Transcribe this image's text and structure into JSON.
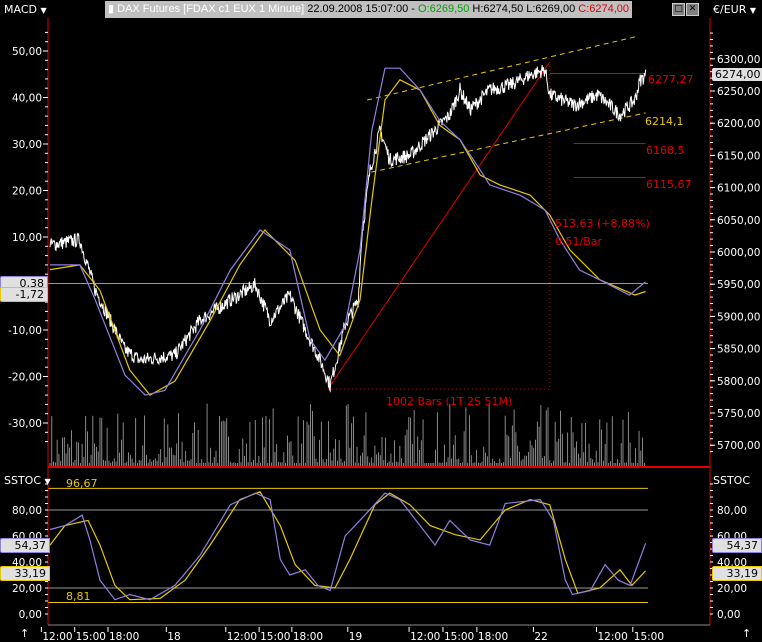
{
  "header": {
    "left_indicator": "MACD",
    "candle_icon": "candle-icon",
    "instrument": "DAX Futures [FDAX c1 EUX  1 Minute]",
    "datetime": "22.09.2008 15:07:00 -",
    "open": "O:6269,50",
    "high": "H:6274,50",
    "low": "L:6269,00",
    "close": "C:6274,00",
    "currency": "€/EUR",
    "maximize": "□",
    "close_btn": "✕"
  },
  "colors": {
    "up": "#00a000",
    "down": "#e00000",
    "macd": "#9080e0",
    "signal": "#e8c800",
    "price": "#ffffff",
    "annot": "#e00000",
    "trend": "#e8c800",
    "stoc_k": "#9080e0",
    "stoc_d": "#e8c800"
  },
  "main": {
    "price_axis": {
      "min": 5675,
      "max": 6350,
      "labels": [
        "6300,00",
        "6250,00",
        "6200,00",
        "6150,00",
        "6100,00",
        "6050,00",
        "6000,00",
        "5950,00",
        "5900,00",
        "5850,00",
        "5800,00",
        "5750,00",
        "5700,00"
      ],
      "values": [
        6300,
        6250,
        6200,
        6150,
        6100,
        6050,
        6000,
        5950,
        5900,
        5850,
        5800,
        5750,
        5700
      ]
    },
    "macd_axis": {
      "labels": [
        "50,00",
        "40,00",
        "30,00",
        "20,00",
        "10,00",
        "-10,00",
        "-20,00",
        "-30,00"
      ],
      "values": [
        50,
        40,
        30,
        20,
        10,
        -10,
        -20,
        -30
      ]
    },
    "last_price_label": "6274,00",
    "macd_label": "0,38",
    "signal_label": "-1,72",
    "annotations": {
      "level_1": "6277,27",
      "level_trend": "6214,1",
      "level_2": "6168,5",
      "level_3": "6115,67",
      "move": "513,63 (+8,88%)",
      "rate": "0,51/Bar",
      "bars": "1002 Bars (1T 2S 51M)"
    },
    "price_anchors": [
      [
        0,
        6011
      ],
      [
        50,
        6019
      ],
      [
        76,
        5941
      ],
      [
        126,
        5848
      ],
      [
        151,
        5832
      ],
      [
        210,
        5840
      ],
      [
        252,
        5894
      ],
      [
        303,
        5925
      ],
      [
        345,
        5949
      ],
      [
        370,
        5894
      ],
      [
        403,
        5933
      ],
      [
        429,
        5879
      ],
      [
        454,
        5832
      ],
      [
        471,
        5793
      ],
      [
        496,
        5887
      ],
      [
        518,
        5925
      ],
      [
        524,
        6026
      ],
      [
        538,
        6127
      ],
      [
        555,
        6189
      ],
      [
        571,
        6143
      ],
      [
        605,
        6150
      ],
      [
        647,
        6189
      ],
      [
        672,
        6213
      ],
      [
        689,
        6252
      ],
      [
        706,
        6221
      ],
      [
        739,
        6252
      ],
      [
        773,
        6259
      ],
      [
        807,
        6275
      ],
      [
        832,
        6283
      ],
      [
        840,
        6244
      ],
      [
        882,
        6228
      ],
      [
        921,
        6244
      ],
      [
        958,
        6213
      ],
      [
        983,
        6236
      ],
      [
        992,
        6267
      ],
      [
        1001,
        6274
      ]
    ],
    "macd": [
      [
        0,
        4
      ],
      [
        50,
        4
      ],
      [
        76,
        -3.5
      ],
      [
        126,
        -19.7
      ],
      [
        160,
        -24
      ],
      [
        193,
        -23
      ],
      [
        252,
        -10
      ],
      [
        303,
        2.9
      ],
      [
        353,
        11.5
      ],
      [
        403,
        7.2
      ],
      [
        437,
        -12
      ],
      [
        462,
        -16.5
      ],
      [
        496,
        -9
      ],
      [
        521,
        7.2
      ],
      [
        541,
        33
      ],
      [
        563,
        46.3
      ],
      [
        588,
        46.3
      ],
      [
        622,
        41.6
      ],
      [
        655,
        35
      ],
      [
        689,
        30.9
      ],
      [
        723,
        24.4
      ],
      [
        739,
        21.2
      ],
      [
        790,
        19
      ],
      [
        832,
        15.8
      ],
      [
        857,
        9.4
      ],
      [
        890,
        2.9
      ],
      [
        924,
        0.8
      ],
      [
        974,
        -2.5
      ],
      [
        1001,
        0.38
      ]
    ],
    "signal": [
      [
        0,
        3
      ],
      [
        50,
        4
      ],
      [
        84,
        -1.5
      ],
      [
        134,
        -18.6
      ],
      [
        168,
        -24
      ],
      [
        210,
        -21
      ],
      [
        269,
        -8
      ],
      [
        319,
        4
      ],
      [
        361,
        11.5
      ],
      [
        412,
        5
      ],
      [
        454,
        -10
      ],
      [
        487,
        -15.5
      ],
      [
        521,
        -3.5
      ],
      [
        541,
        18
      ],
      [
        563,
        39.5
      ],
      [
        588,
        43.8
      ],
      [
        622,
        41.6
      ],
      [
        655,
        34
      ],
      [
        689,
        30.9
      ],
      [
        723,
        23.3
      ],
      [
        756,
        21.2
      ],
      [
        807,
        19
      ],
      [
        840,
        14.7
      ],
      [
        874,
        7.2
      ],
      [
        924,
        0.8
      ],
      [
        983,
        -2.5
      ],
      [
        1001,
        -1.72
      ]
    ],
    "trend_upper": [
      [
        533,
        6236
      ],
      [
        983,
        6334
      ]
    ],
    "trend_lower": [
      [
        540,
        6124
      ],
      [
        1001,
        6216
      ]
    ],
    "measure": {
      "from": [
        467,
        5787
      ],
      "to": [
        840,
        6295
      ]
    }
  },
  "stoc": {
    "title": "SSTOC",
    "right_title": "SSTOC",
    "axis_labels": [
      "80,00",
      "60,00",
      "40,00",
      "20,00",
      "0,00"
    ],
    "axis_values": [
      80,
      60,
      40,
      20,
      0
    ],
    "upper_level": "96,67",
    "lower_level": "8,81",
    "k_label": "54,37",
    "d_label": "33,19",
    "k": [
      [
        0,
        65
      ],
      [
        25,
        68
      ],
      [
        54,
        76
      ],
      [
        67,
        57
      ],
      [
        84,
        26
      ],
      [
        109,
        11
      ],
      [
        134,
        15
      ],
      [
        168,
        11
      ],
      [
        210,
        22
      ],
      [
        252,
        45
      ],
      [
        303,
        84
      ],
      [
        345,
        93
      ],
      [
        370,
        88
      ],
      [
        387,
        42
      ],
      [
        403,
        30
      ],
      [
        429,
        34
      ],
      [
        450,
        22
      ],
      [
        471,
        18
      ],
      [
        496,
        60
      ],
      [
        529,
        76
      ],
      [
        563,
        93
      ],
      [
        588,
        88
      ],
      [
        622,
        68
      ],
      [
        647,
        53
      ],
      [
        672,
        72
      ],
      [
        706,
        57
      ],
      [
        739,
        53
      ],
      [
        765,
        85
      ],
      [
        824,
        88
      ],
      [
        846,
        72
      ],
      [
        866,
        26
      ],
      [
        878,
        15
      ],
      [
        908,
        18
      ],
      [
        933,
        38
      ],
      [
        955,
        26
      ],
      [
        975,
        22
      ],
      [
        1001,
        54.37
      ]
    ],
    "d": [
      [
        0,
        53
      ],
      [
        25,
        68
      ],
      [
        64,
        72
      ],
      [
        84,
        53
      ],
      [
        109,
        22
      ],
      [
        134,
        11
      ],
      [
        185,
        12
      ],
      [
        227,
        26
      ],
      [
        269,
        53
      ],
      [
        319,
        88
      ],
      [
        353,
        94
      ],
      [
        387,
        68
      ],
      [
        412,
        38
      ],
      [
        445,
        22
      ],
      [
        479,
        20
      ],
      [
        504,
        42
      ],
      [
        546,
        84
      ],
      [
        571,
        93
      ],
      [
        605,
        84
      ],
      [
        639,
        68
      ],
      [
        681,
        61
      ],
      [
        723,
        57
      ],
      [
        765,
        80
      ],
      [
        807,
        88
      ],
      [
        840,
        84
      ],
      [
        866,
        42
      ],
      [
        887,
        16
      ],
      [
        924,
        20
      ],
      [
        958,
        34
      ],
      [
        978,
        22
      ],
      [
        1001,
        33.19
      ]
    ]
  },
  "time_axis": {
    "labels": [
      "12:00",
      "15:00",
      "18:00",
      "18",
      "12:00",
      "15:00",
      "18:00",
      "19",
      "12:00",
      "15:00",
      "18:00",
      "22",
      "12:00",
      "15:00"
    ],
    "bars": [
      9,
      65,
      121,
      219,
      319,
      375,
      430,
      524,
      627,
      684,
      741,
      836,
      942,
      1003
    ]
  }
}
